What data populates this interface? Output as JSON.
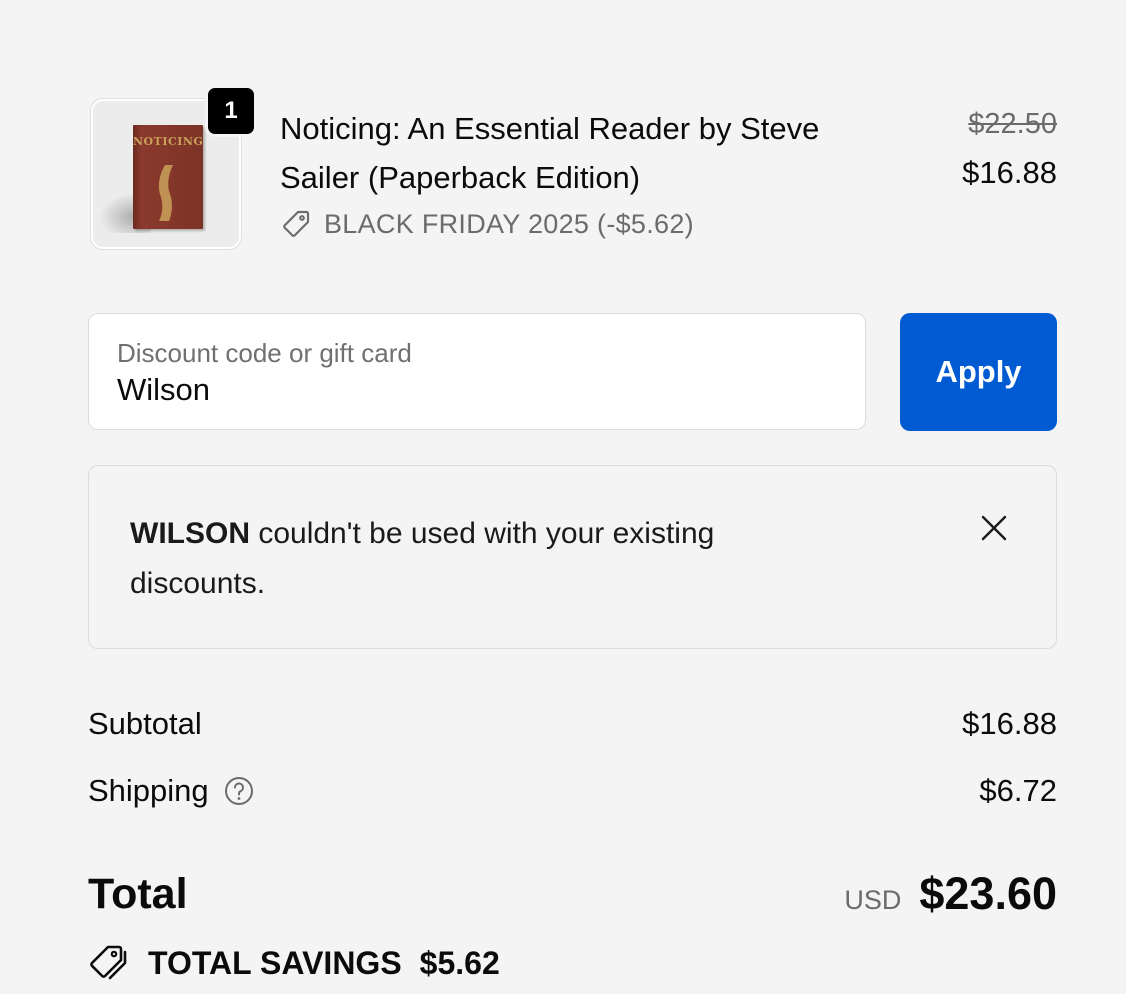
{
  "product": {
    "quantity": "1",
    "title": "Noticing: An Essential Reader by Steve Sailer (Paperback Edition)",
    "cover_text": "NOTICING",
    "discount_label": "BLACK FRIDAY 2025 (-$5.62)",
    "original_price": "$22.50",
    "price": "$16.88"
  },
  "discount_field": {
    "label": "Discount code or gift card",
    "value": "Wilson"
  },
  "apply_button": "Apply",
  "notice": {
    "code": "WILSON",
    "message": " couldn't be used with your existing discounts."
  },
  "summary": {
    "subtotal_label": "Subtotal",
    "subtotal_value": "$16.88",
    "shipping_label": "Shipping",
    "shipping_value": "$6.72",
    "total_label": "Total",
    "currency": "USD",
    "total_value": "$23.60",
    "savings_label": "TOTAL SAVINGS",
    "savings_value": "$5.62"
  },
  "colors": {
    "accent": "#005bd3",
    "background": "#f4f4f4",
    "muted_text": "#6b6b6b"
  }
}
